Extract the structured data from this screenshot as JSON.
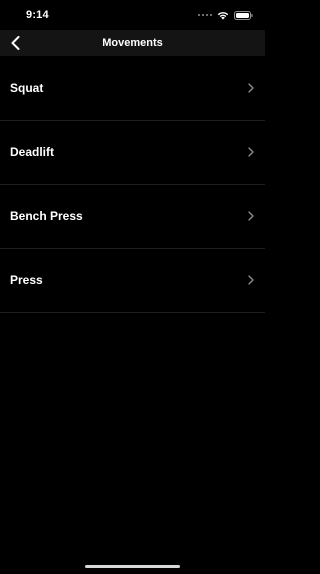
{
  "status_bar": {
    "time": "9:14",
    "icons": [
      "signal-dots-icon",
      "wifi-icon",
      "battery-icon"
    ]
  },
  "nav": {
    "title": "Movements",
    "back_icon": "chevron-left-icon"
  },
  "movements": [
    {
      "label": "Squat"
    },
    {
      "label": "Deadlift"
    },
    {
      "label": "Bench Press"
    },
    {
      "label": "Press"
    }
  ],
  "colors": {
    "background": "#000000",
    "nav_background": "#141414",
    "separator": "#1f1f1f",
    "text": "#ffffff",
    "chevron": "#8e8e93"
  }
}
